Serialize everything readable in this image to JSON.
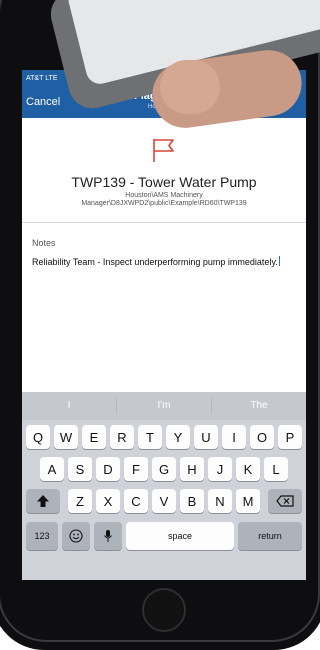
{
  "status_bar": {
    "carrier": "AT&T  LTE"
  },
  "navbar": {
    "cancel_label": "Cancel",
    "title": "Flag",
    "subtitle": "Hou"
  },
  "asset": {
    "title": "TWP139 - Tower Water Pump",
    "path_line1": "Houston\\AMS Machinery",
    "path_line2": "Manager\\D8JXWPD2\\public\\Example\\RD60\\TWP139"
  },
  "notes": {
    "label": "Notes",
    "text": "Reliability Team - Inspect underperforming pump immediately."
  },
  "keyboard": {
    "suggestions": [
      "I",
      "I'm",
      "The"
    ],
    "row1": [
      "Q",
      "W",
      "E",
      "R",
      "T",
      "Y",
      "U",
      "I",
      "O",
      "P"
    ],
    "row2": [
      "A",
      "S",
      "D",
      "F",
      "G",
      "H",
      "J",
      "K",
      "L"
    ],
    "row3": [
      "Z",
      "X",
      "C",
      "V",
      "B",
      "N",
      "M"
    ],
    "numbers_label": "123",
    "space_label": "space",
    "return_label": "return"
  },
  "colors": {
    "nav": "#1f5fa3",
    "flag": "#d9463c",
    "keyboard": "#cfd3d9"
  }
}
